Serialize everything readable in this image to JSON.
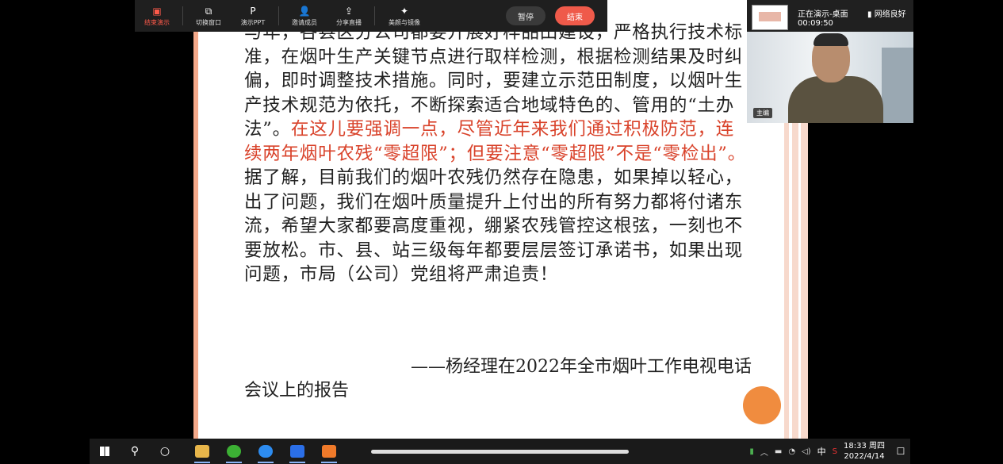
{
  "toolbar": {
    "buttons": [
      {
        "label": "结束演示",
        "icon": "▣",
        "icon_name": "end-presentation-icon"
      },
      {
        "label": "切换窗口",
        "icon": "⧉",
        "icon_name": "switch-window-icon"
      },
      {
        "label": "演示PPT",
        "icon": "P",
        "icon_name": "ppt-icon"
      },
      {
        "label": "邀请成员",
        "icon": "👤",
        "icon_name": "invite-member-icon"
      },
      {
        "label": "分享直播",
        "icon": "⇪",
        "icon_name": "share-live-icon"
      },
      {
        "label": "美颜与镜像",
        "icon": "✦",
        "icon_name": "beauty-mirror-icon"
      }
    ],
    "pause_label": "暂停",
    "stop_label": "结束"
  },
  "video": {
    "status": "正在演示-桌面",
    "elapsed": "00:09:50",
    "network": "网络良好",
    "network_icon": "signal-icon",
    "host_tag": "主编"
  },
  "slide": {
    "paragraph_before_red": "与年，各县区分公司都要开展好样品田建设，严格执行技术标准，在烟叶生产关键节点进行取样检测，根据检测结果及时纠偏，即时调整技术措施。同时，要建立示范田制度，以烟叶生产技术规范为依托，不断探索适合地域特色的、管用的“土办法”。",
    "paragraph_red": "在这儿要强调一点，尽管近年来我们通过积极防范，连续两年烟叶农残“零超限”；但要注意“零超限”不是“零检出”。",
    "paragraph_after_red": "据了解，目前我们的烟叶农残仍然存在隐患，如果掉以轻心，出了问题，我们在烟叶质量提升上付出的所有努力都将付诸东流，希望大家都要高度重视，绷紧农残管控这根弦，一刻也不要放松。市、县、站三级每年都要层层签订承诺书，如果出现问题，市局（公司）党组将严肃追责！",
    "attribution_line1": "——杨经理在2022年全市烟叶工作电视电话",
    "attribution_line2": "会议上的报告",
    "accent_red": "#d9432b",
    "accent_orange": "#f08c3f"
  },
  "taskbar": {
    "apps": [
      {
        "name": "file-explorer-icon",
        "color": "#e8b64a"
      },
      {
        "name": "wechat-icon",
        "color": "#3cb034"
      },
      {
        "name": "browser-search-icon",
        "color": "#2d8cf0"
      },
      {
        "name": "wps-writer-icon",
        "color": "#2b6fe8"
      },
      {
        "name": "presentation-app-icon",
        "color": "#f07a2a"
      }
    ],
    "tray": {
      "ime_label": "中",
      "time": "18:33 周四",
      "date": "2022/4/14"
    }
  }
}
